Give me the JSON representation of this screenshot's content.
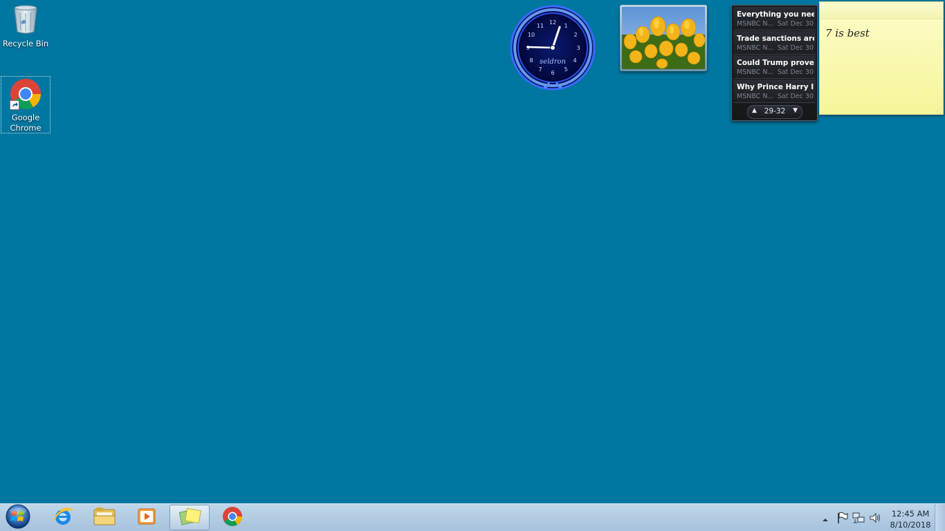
{
  "desktop": {
    "icons": [
      {
        "label": "Recycle Bin",
        "icon": "recycle-bin-icon"
      },
      {
        "label": "Google Chrome",
        "icon": "chrome-icon"
      }
    ]
  },
  "gadgets": {
    "clock": {
      "brand": "seldron",
      "time_shown": "12:45"
    },
    "feed": {
      "items": [
        {
          "title": "Everything you need ...",
          "source": "MSNBC N...",
          "date": "Sat Dec 30"
        },
        {
          "title": "Trade sanctions are ...",
          "source": "MSNBC N...",
          "date": "Sat Dec 30"
        },
        {
          "title": "Could Trump prove S...",
          "source": "MSNBC N...",
          "date": "Sat Dec 30"
        },
        {
          "title": "Why Prince Harry In...",
          "source": "MSNBC N...",
          "date": "Sat Dec 30"
        }
      ],
      "page": "29-32"
    },
    "note": {
      "text": "7 is best"
    }
  },
  "taskbar": {
    "items": [
      {
        "icon": "start-orb-icon"
      },
      {
        "icon": "internet-explorer-icon"
      },
      {
        "icon": "file-explorer-icon"
      },
      {
        "icon": "media-player-icon"
      },
      {
        "icon": "sticky-notes-icon",
        "active": true
      },
      {
        "icon": "chrome-icon"
      }
    ],
    "tray": {
      "icons": [
        "show-hidden-icons-icon",
        "action-center-flag-icon",
        "network-icon",
        "volume-icon"
      ],
      "time": "12:45 AM",
      "date": "8/10/2018"
    }
  },
  "colors": {
    "desktop_bg": "#0077a1",
    "taskbar": "#bfd6ea",
    "note": "#fdfdc9"
  }
}
